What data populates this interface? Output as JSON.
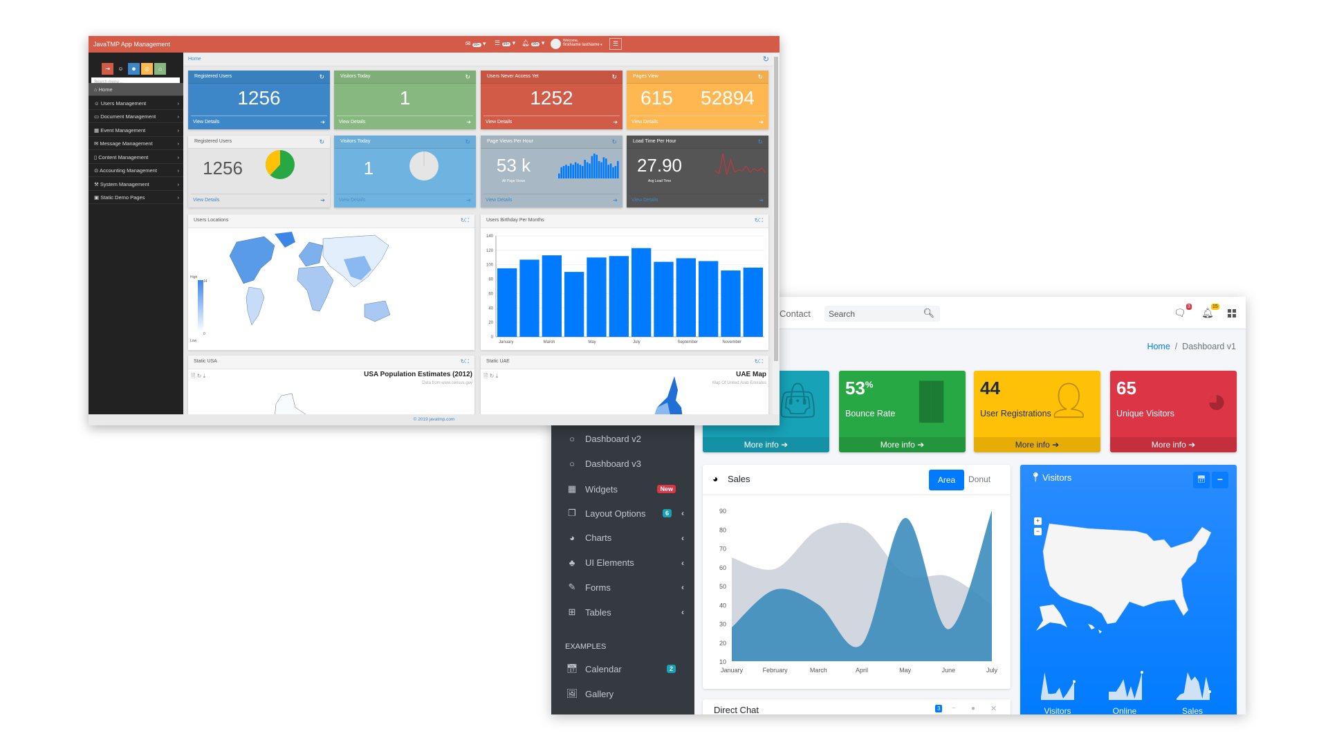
{
  "javatmp": {
    "title": "JavaTMP App Management",
    "header_badges": [
      {
        "icon": "envelope-icon",
        "count": "99+"
      },
      {
        "icon": "tasks-icon",
        "count": "99+"
      },
      {
        "icon": "bell-icon",
        "count": "99+"
      }
    ],
    "welcome": "Welcome,",
    "user_name": "firstName lastName",
    "breadcrumb": "Home",
    "search_placeholder": "Search menu ...",
    "menu": [
      {
        "icon": "home-icon",
        "label": "Home"
      },
      {
        "icon": "users-icon",
        "label": "Users Management"
      },
      {
        "icon": "folder-icon",
        "label": "Document Management"
      },
      {
        "icon": "calendar-icon",
        "label": "Event Management"
      },
      {
        "icon": "envelope-icon",
        "label": "Message Management"
      },
      {
        "icon": "file-icon",
        "label": "Content Management"
      },
      {
        "icon": "lightbulb-icon",
        "label": "Accounting Management"
      },
      {
        "icon": "wrench-icon",
        "label": "System Management"
      },
      {
        "icon": "image-icon",
        "label": "Static Demo Pages"
      }
    ],
    "tiles_row1": [
      {
        "title": "Registered Users",
        "value": "1256",
        "footer": "View Details",
        "color": "#3d87c9"
      },
      {
        "title": "Visitors Today",
        "value": "1",
        "footer": "View Details",
        "color": "#87b87f"
      },
      {
        "title": "Users Never Access Yet",
        "value": "1252",
        "footer": "View Details",
        "color": "#d15b47"
      },
      {
        "title": "Pages View",
        "value": "615",
        "value2": "52894",
        "footer": "View Details",
        "color": "#ffb752"
      }
    ],
    "tiles_row2": [
      {
        "title": "Registered Users",
        "value": "1256",
        "footer": "View Details",
        "pie": [
          0.38,
          0.62
        ]
      },
      {
        "title": "Visitors Today",
        "value": "1",
        "footer": "View Details"
      },
      {
        "title": "Page Views Per Hour",
        "value": "53 k",
        "sub": "All Page Views",
        "footer": "View Details",
        "bars": [
          4,
          9,
          10,
          11,
          10,
          12,
          11,
          13,
          12,
          11,
          10,
          15,
          13,
          12,
          18,
          20,
          19,
          14,
          13,
          17,
          16,
          11,
          12,
          9,
          10,
          14
        ]
      },
      {
        "title": "Load Time Per Hour",
        "value": "27.90",
        "sub": "Avg Load Time",
        "footer": "View Details",
        "line": [
          12,
          8,
          40,
          6,
          30,
          10,
          14,
          12,
          20,
          10,
          16,
          12,
          17,
          9
        ]
      }
    ],
    "panels": {
      "map_title": "Users Locations",
      "legend_high": "High",
      "legend_low": "Low",
      "legend_max": "14",
      "legend_min": "0",
      "bar_title": "Users Birthday Per Months",
      "usa_title": "Static USA",
      "usa_chart_title": "USA Population Estimates (2012)",
      "usa_chart_sub": "Data from www.census.gov",
      "uae_title": "Static UAE",
      "uae_chart_title": "UAE Map",
      "uae_chart_sub": "Map Of United Arab Emirates"
    },
    "footer": "© 2019 javatmp.com"
  },
  "chart_data": [
    {
      "type": "bar",
      "title": "Users Birthday Per Months",
      "categories": [
        "January",
        "February",
        "March",
        "April",
        "May",
        "June",
        "July",
        "August",
        "September",
        "October",
        "November",
        "December"
      ],
      "tick_labels": [
        "January",
        "March",
        "May",
        "July",
        "September",
        "November"
      ],
      "values": [
        95,
        107,
        113,
        90,
        110,
        112,
        123,
        104,
        109,
        105,
        92,
        96
      ],
      "ylim": [
        0,
        140
      ],
      "yticks": [
        0,
        20,
        40,
        60,
        80,
        100,
        120,
        140
      ],
      "grid": true,
      "color": "#007bff"
    },
    {
      "type": "area",
      "title": "Sales",
      "categories": [
        "January",
        "February",
        "March",
        "April",
        "May",
        "June",
        "July"
      ],
      "series": [
        {
          "values": [
            65,
            59,
            80,
            81,
            56,
            55,
            40
          ],
          "color": "#d2d6de"
        },
        {
          "values": [
            28,
            48,
            40,
            19,
            86,
            27,
            90
          ],
          "color": "#3c8dbc"
        }
      ],
      "ylim": [
        10,
        90
      ],
      "yticks": [
        10,
        20,
        30,
        40,
        50,
        60,
        70,
        80,
        90
      ]
    }
  ],
  "adminlte": {
    "nav_contact": "Contact",
    "search_placeholder": "Search",
    "messages_badge": "3",
    "notifications_badge": "15",
    "breadcrumb_home": "Home",
    "breadcrumb_current": "Dashboard v1",
    "sidebar": [
      {
        "icon": "circle-icon",
        "label": "Dashboard v2"
      },
      {
        "icon": "circle-icon",
        "label": "Dashboard v3"
      },
      {
        "icon": "th-icon",
        "label": "Widgets",
        "badge": "New",
        "badge_color": "#dc3545"
      },
      {
        "icon": "copy-icon",
        "label": "Layout Options",
        "badge": "6",
        "badge_color": "#17a2b8",
        "chevron": true
      },
      {
        "icon": "pie-chart-icon",
        "label": "Charts",
        "chevron": true
      },
      {
        "icon": "tree-icon",
        "label": "UI Elements",
        "chevron": true
      },
      {
        "icon": "edit-icon",
        "label": "Forms",
        "chevron": true
      },
      {
        "icon": "table-icon",
        "label": "Tables",
        "chevron": true
      }
    ],
    "examples_header": "EXAMPLES",
    "examples": [
      {
        "icon": "calendar-icon",
        "label": "Calendar",
        "badge": "2",
        "badge_color": "#17a2b8"
      },
      {
        "icon": "image-icon",
        "label": "Gallery"
      }
    ],
    "small_boxes": [
      {
        "value": "",
        "label": "",
        "footer": "More info",
        "color": "#17a2b8",
        "icon": "shopping-bag-icon"
      },
      {
        "value": "53",
        "sup": "%",
        "label": "Bounce Rate",
        "footer": "More info",
        "color": "#28a745",
        "icon": "bar-chart-icon"
      },
      {
        "value": "44",
        "label": "User Registrations",
        "footer": "More info",
        "color": "#ffc107",
        "icon": "user-plus-icon"
      },
      {
        "value": "65",
        "label": "Unique Visitors",
        "footer": "More info",
        "color": "#dc3545",
        "icon": "pie-chart-icon"
      }
    ],
    "sales": {
      "title": "Sales",
      "tab_area": "Area",
      "tab_donut": "Donut"
    },
    "visitors": {
      "title": "Visitors",
      "sparklines": [
        {
          "label": "Visitors",
          "values": [
            10,
            90,
            20,
            20,
            22,
            40,
            5,
            20,
            40,
            60
          ]
        },
        {
          "label": "Online",
          "values": [
            30,
            30,
            30,
            50,
            75,
            10,
            50,
            5,
            50,
            100
          ]
        },
        {
          "label": "Sales",
          "values": [
            5,
            20,
            25,
            100,
            70,
            85,
            65,
            5,
            85,
            30
          ]
        }
      ]
    },
    "direct_chat": {
      "title": "Direct Chat",
      "badge": "3"
    }
  }
}
